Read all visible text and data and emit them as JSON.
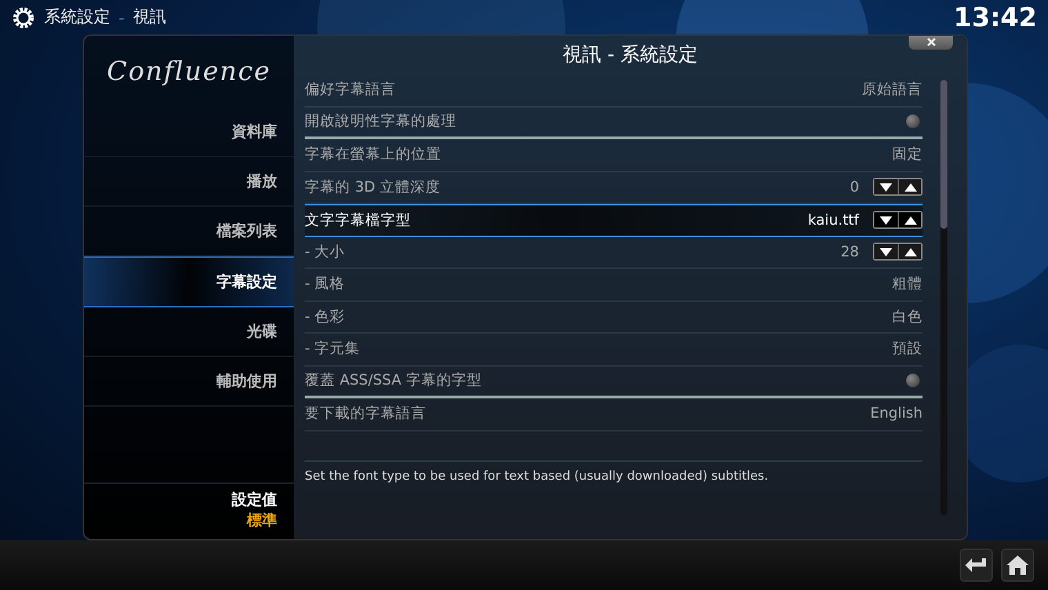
{
  "header": {
    "breadcrumb": [
      "系統設定",
      "-",
      "視訊"
    ],
    "clock": "13:42"
  },
  "dialog": {
    "title": "視訊 - 系統設定",
    "logo": "Confluence"
  },
  "sidebar": {
    "items": [
      {
        "label": "資料庫",
        "selected": false
      },
      {
        "label": "播放",
        "selected": false
      },
      {
        "label": "檔案列表",
        "selected": false
      },
      {
        "label": "字幕設定",
        "selected": true
      },
      {
        "label": "光碟",
        "selected": false
      },
      {
        "label": "輔助使用",
        "selected": false
      }
    ],
    "settings_level": {
      "label": "設定值",
      "value": "標準"
    }
  },
  "settings": [
    {
      "kind": "value",
      "label": "偏好字幕語言",
      "value": "原始語言",
      "selected": false
    },
    {
      "kind": "toggle",
      "label": "開啟說明性字幕的處理",
      "on": false,
      "selected": false
    },
    {
      "kind": "value",
      "label": "字幕在螢幕上的位置",
      "value": "固定",
      "selected": false
    },
    {
      "kind": "spinner",
      "label": "字幕的 3D 立體深度",
      "value": "0",
      "selected": false
    },
    {
      "kind": "spinner",
      "label": "文字字幕檔字型",
      "value": "kaiu.ttf",
      "selected": true
    },
    {
      "kind": "spinner",
      "label": "- 大小",
      "value": "28",
      "selected": false
    },
    {
      "kind": "value",
      "label": "- 風格",
      "value": "粗體",
      "selected": false
    },
    {
      "kind": "value",
      "label": "- 色彩",
      "value": "白色",
      "selected": false
    },
    {
      "kind": "value",
      "label": "- 字元集",
      "value": "預設",
      "selected": false
    },
    {
      "kind": "toggle",
      "label": "覆蓋 ASS/SSA 字幕的字型",
      "on": false,
      "selected": false
    },
    {
      "kind": "value",
      "label": "要下載的字幕語言",
      "value": "English",
      "selected": false
    }
  ],
  "description": "Set the font type to be used for text based (usually downloaded) subtitles."
}
